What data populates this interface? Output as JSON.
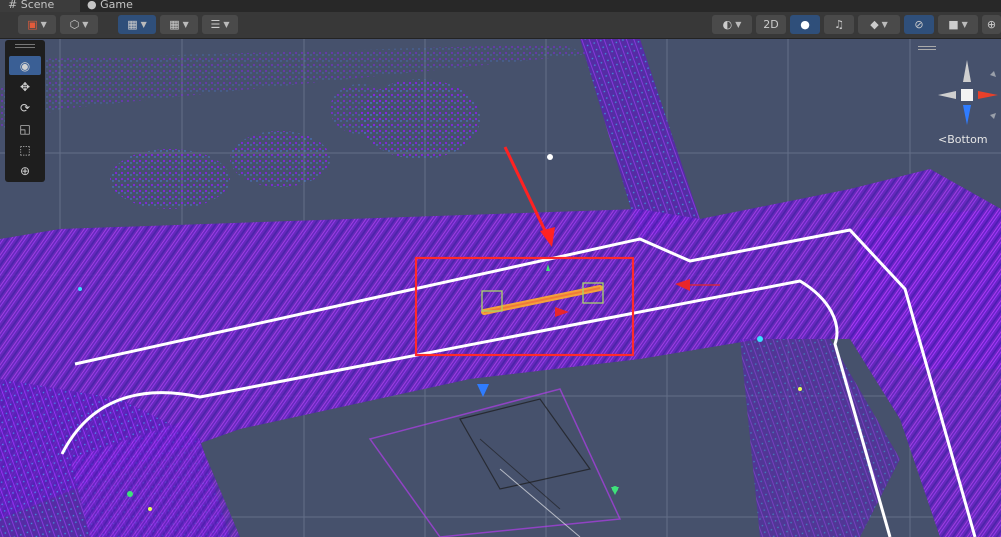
{
  "tabs": {
    "scene_label": "# Scene",
    "game_label": "Game"
  },
  "toolbar": {
    "mode_2d": "2D"
  },
  "gizmo": {
    "view_label": "<Bottom"
  },
  "icons": {
    "shading": "shading-mode-icon",
    "view_tool": "eye-icon",
    "move_tool": "move-arrows-icon",
    "rotate_tool": "rotate-icon",
    "scale_tool": "scale-icon",
    "rect_tool": "rect-tool-icon",
    "transform_tool": "transform-icon"
  },
  "colors": {
    "scene_background": "#46516c",
    "point_cloud": "#8b1ff0",
    "path_line": "#ffffff",
    "highlight_box": "#ff2a2a",
    "active_button": "#3a5f95"
  }
}
